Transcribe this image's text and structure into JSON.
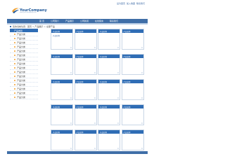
{
  "header": {
    "logo_text": "YourCompany",
    "logo_subtitle": "www.yourcompany.com",
    "top_links": [
      "设为首页",
      "加入收藏",
      "联系我们"
    ]
  },
  "nav": {
    "items": [
      "首 页",
      "公司简介",
      "产品展示",
      "公司新闻",
      "在线留言",
      "联系我们"
    ]
  },
  "breadcrumb": {
    "text": "您的当前位置：首页 > 产品展示 > 全部产品"
  },
  "sidebar": {
    "title": "产品类别",
    "items": [
      "产品分类",
      "产品分类",
      "产品分类",
      "产品分类",
      "产品分类",
      "产品分类",
      "产品分类",
      "产品分类",
      "产品分类",
      "产品分类",
      "产品分类",
      "产品分类",
      "产品分类",
      "产品分类",
      "产品分类",
      "产品分类"
    ]
  },
  "products": [
    [
      {
        "title": "产品名称",
        "link": "产品名称"
      },
      {
        "title": "产品名称",
        "link": ""
      },
      {
        "title": "产品名称",
        "link": ""
      },
      {
        "title": "产品名称",
        "link": ""
      }
    ],
    [
      {
        "title": "产品名称",
        "link": ""
      },
      {
        "title": "产品名称",
        "link": ""
      },
      {
        "title": "产品名称",
        "link": ""
      },
      {
        "title": "产品名称",
        "link": ""
      }
    ],
    [
      {
        "title": "产品名称",
        "link": ""
      },
      {
        "title": "产品名称",
        "link": ""
      },
      {
        "title": "产品名称",
        "link": ""
      },
      {
        "title": "产品名称",
        "link": ""
      }
    ],
    [
      {
        "title": "产品名称",
        "link": ""
      },
      {
        "title": "产品名称",
        "link": ""
      },
      {
        "title": "产品名称",
        "link": ""
      },
      {
        "title": "产品名称",
        "link": ""
      }
    ],
    [
      {
        "title": "产品名称",
        "link": ""
      },
      {
        "title": "产品名称",
        "link": ""
      },
      {
        "title": "产品名称",
        "link": ""
      },
      {
        "title": "产品名称",
        "link": ""
      }
    ]
  ],
  "colors": {
    "brand_blue": "#2f6db5",
    "nav_blue": "#3f6ea7",
    "accent_orange": "#f0a030"
  }
}
